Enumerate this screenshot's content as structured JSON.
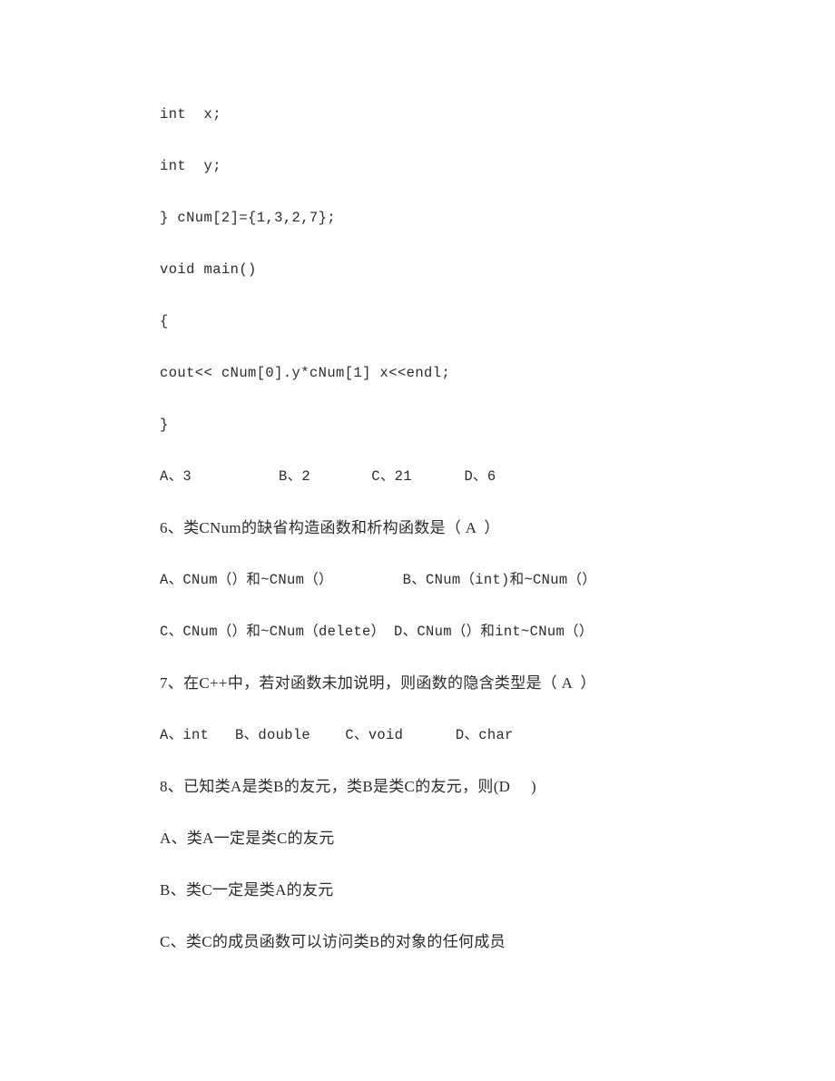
{
  "document": {
    "background_color": "#ffffff",
    "text_color": "#2b2b2b",
    "lines": [
      {
        "id": "code-int-x",
        "kind": "code",
        "text": "int  x;"
      },
      {
        "id": "code-int-y",
        "kind": "code",
        "text": "int  y;"
      },
      {
        "id": "code-cnum-init",
        "kind": "code",
        "text": "} cNum[2]={1,3,2,7};"
      },
      {
        "id": "code-void-main",
        "kind": "code",
        "text": "void main()"
      },
      {
        "id": "code-open-brace",
        "kind": "code",
        "text": "{"
      },
      {
        "id": "code-cout",
        "kind": "code",
        "text": "cout<< cNum[0].y*cNum[1] x<<endl;"
      },
      {
        "id": "code-close-brace",
        "kind": "code",
        "text": "}"
      },
      {
        "id": "q5-options",
        "kind": "opt",
        "text": "A、3          B、2       C、21      D、6"
      },
      {
        "id": "q6-stem",
        "kind": "mix",
        "text": "6、类CNum的缺省构造函数和析构函数是（ A  ）"
      },
      {
        "id": "q6-options-ab",
        "kind": "opt",
        "text": "A、CNum（）和~CNum（）        B、CNum（int)和~CNum（）"
      },
      {
        "id": "q6-options-cd",
        "kind": "opt",
        "text": "C、CNum（）和~CNum（delete） D、CNum（）和int~CNum（）"
      },
      {
        "id": "q7-stem",
        "kind": "mix",
        "text": "7、在C++中，若对函数未加说明，则函数的隐含类型是（ A  ）"
      },
      {
        "id": "q7-options",
        "kind": "opt",
        "text": "A、int   B、double    C、void      D、char"
      },
      {
        "id": "q8-stem",
        "kind": "mix",
        "text": "8、已知类A是类B的友元，类B是类C的友元，则(D     )"
      },
      {
        "id": "q8-option-a",
        "kind": "mix",
        "text": "A、类A一定是类C的友元"
      },
      {
        "id": "q8-option-b",
        "kind": "mix",
        "text": "B、类C一定是类A的友元"
      },
      {
        "id": "q8-option-c",
        "kind": "mix",
        "text": "C、类C的成员函数可以访问类B的对象的任何成员"
      }
    ]
  }
}
